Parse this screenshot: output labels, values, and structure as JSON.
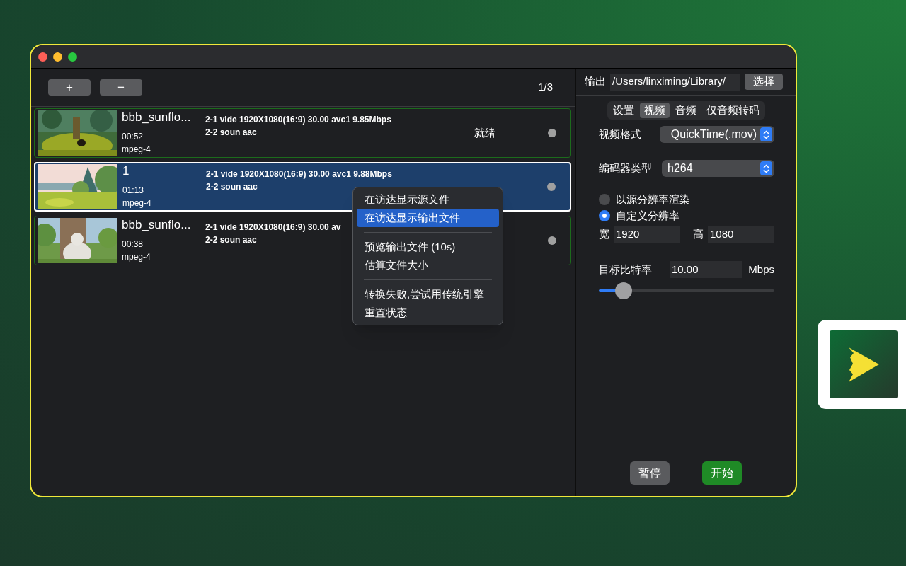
{
  "toolbar": {
    "buttons": [
      "+",
      "−"
    ],
    "counter": "1/3"
  },
  "files": [
    {
      "name": "bbb_sunflo...",
      "duration": "00:52",
      "format": "mpeg-4",
      "streams": [
        "2-1 vide 1920X1080(16:9) 30.00 avc1 9.85Mbps",
        "2-2 soun aac"
      ],
      "status": "就绪",
      "selected": false
    },
    {
      "name": "1",
      "duration": "01:13",
      "format": "mpeg-4",
      "streams": [
        "2-1 vide 1920X1080(16:9) 30.00 avc1 9.88Mbps",
        "2-2 soun aac"
      ],
      "selected": true
    },
    {
      "name": "bbb_sunflo...",
      "duration": "00:38",
      "format": "mpeg-4",
      "streams": [
        "2-1 vide 1920X1080(16:9) 30.00 av",
        "2-2 soun aac"
      ],
      "selected": false
    }
  ],
  "context_menu": {
    "sections": [
      [
        {
          "label": "在访达显示源文件",
          "selected": false
        },
        {
          "label": "在访达显示输出文件",
          "selected": true
        }
      ],
      [
        {
          "label": "预览输出文件 (10s)",
          "selected": false
        },
        {
          "label": "估算文件大小",
          "selected": false
        }
      ],
      [
        {
          "label": "转换失败,尝试用传统引擎",
          "selected": false
        },
        {
          "label": "重置状态",
          "selected": false
        }
      ]
    ]
  },
  "output": {
    "label": "输出",
    "path": "/Users/linximing/Library/",
    "button": "选择"
  },
  "tabs": [
    {
      "label": "设置",
      "selected": false
    },
    {
      "label": "视频",
      "selected": true
    },
    {
      "label": "音频",
      "selected": false
    },
    {
      "label": "仅音频转码",
      "selected": false
    }
  ],
  "video_format": {
    "label": "视频格式",
    "value": "QuickTime(.mov)"
  },
  "codec": {
    "label": "编码器类型",
    "value": "h264"
  },
  "resolution_options": [
    {
      "label": "以源分辨率渲染",
      "selected": false
    },
    {
      "label": "自定义分辨率",
      "selected": true
    }
  ],
  "width": {
    "label": "宽",
    "value": "1920"
  },
  "height": {
    "label": "高",
    "value": "1080"
  },
  "bitrate": {
    "label": "目标比特率",
    "value": "10.00",
    "unit": "Mbps",
    "level": 0.14
  },
  "actions": [
    {
      "label": "暂停",
      "kind": "secondary"
    },
    {
      "label": "开始",
      "kind": "primary"
    }
  ]
}
